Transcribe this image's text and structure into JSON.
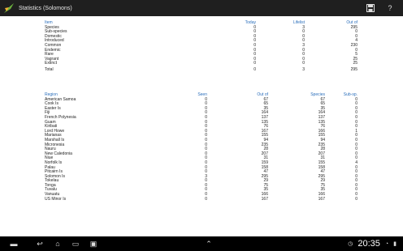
{
  "app": {
    "title": "Statistics (Solomons)",
    "icons": {
      "logo": "bird-logo-icon",
      "save": "save-icon",
      "help": "help-icon"
    }
  },
  "summary": {
    "headers": [
      "Item",
      "Today",
      "Lifelist",
      "Out of"
    ],
    "rows": [
      {
        "item": "Species",
        "today": "0",
        "lifelist": "3",
        "outof": "295"
      },
      {
        "item": "Sub-species",
        "today": "0",
        "lifelist": "0",
        "outof": "0"
      },
      {
        "item": "Domestic",
        "today": "0",
        "lifelist": "0",
        "outof": "0"
      },
      {
        "item": "Introduced",
        "today": "0",
        "lifelist": "0",
        "outof": "4"
      },
      {
        "item": "Common",
        "today": "0",
        "lifelist": "3",
        "outof": "230"
      },
      {
        "item": "Endemic",
        "today": "0",
        "lifelist": "0",
        "outof": "0"
      },
      {
        "item": "Rare",
        "today": "0",
        "lifelist": "0",
        "outof": "5"
      },
      {
        "item": "Vagrant",
        "today": "0",
        "lifelist": "0",
        "outof": "25"
      },
      {
        "item": "Extinct",
        "today": "0",
        "lifelist": "0",
        "outof": "25"
      },
      {
        "item": "Total",
        "today": "0",
        "lifelist": "3",
        "outof": "295"
      }
    ]
  },
  "regions": {
    "headers": [
      "Region",
      "Seen",
      "Out of",
      "Species",
      "Sub-sp."
    ],
    "rows": [
      {
        "region": "American Samoa",
        "seen": "0",
        "outof": "67",
        "species": "67",
        "subsp": "0"
      },
      {
        "region": "Cook Is",
        "seen": "0",
        "outof": "65",
        "species": "65",
        "subsp": "0"
      },
      {
        "region": "Easter Is",
        "seen": "0",
        "outof": "35",
        "species": "35",
        "subsp": "0"
      },
      {
        "region": "Fiji",
        "seen": "0",
        "outof": "164",
        "species": "164",
        "subsp": "0"
      },
      {
        "region": "French Polynesia",
        "seen": "0",
        "outof": "137",
        "species": "137",
        "subsp": "0"
      },
      {
        "region": "Guam",
        "seen": "0",
        "outof": "135",
        "species": "135",
        "subsp": "0"
      },
      {
        "region": "Kiribati",
        "seen": "0",
        "outof": "76",
        "species": "76",
        "subsp": "0"
      },
      {
        "region": "Lord Howe",
        "seen": "0",
        "outof": "167",
        "species": "166",
        "subsp": "1"
      },
      {
        "region": "Marianas",
        "seen": "0",
        "outof": "155",
        "species": "155",
        "subsp": "0"
      },
      {
        "region": "Marshall Is",
        "seen": "0",
        "outof": "94",
        "species": "94",
        "subsp": "0"
      },
      {
        "region": "Micronesia",
        "seen": "0",
        "outof": "235",
        "species": "235",
        "subsp": "0"
      },
      {
        "region": "Nauru",
        "seen": "0",
        "outof": "28",
        "species": "28",
        "subsp": "0"
      },
      {
        "region": "New Caledonia",
        "seen": "0",
        "outof": "207",
        "species": "207",
        "subsp": "0"
      },
      {
        "region": "Niue",
        "seen": "0",
        "outof": "31",
        "species": "31",
        "subsp": "0"
      },
      {
        "region": "Norfolk Is",
        "seen": "0",
        "outof": "159",
        "species": "155",
        "subsp": "4"
      },
      {
        "region": "Palau",
        "seen": "0",
        "outof": "158",
        "species": "158",
        "subsp": "0"
      },
      {
        "region": "Pitcairn Is",
        "seen": "0",
        "outof": "47",
        "species": "47",
        "subsp": "0"
      },
      {
        "region": "Solomon Is",
        "seen": "3",
        "outof": "295",
        "species": "295",
        "subsp": "0"
      },
      {
        "region": "Tokelau",
        "seen": "0",
        "outof": "29",
        "species": "29",
        "subsp": "0"
      },
      {
        "region": "Tonga",
        "seen": "0",
        "outof": "75",
        "species": "75",
        "subsp": "0"
      },
      {
        "region": "Tuvalu",
        "seen": "0",
        "outof": "35",
        "species": "35",
        "subsp": "0"
      },
      {
        "region": "Vanuatu",
        "seen": "0",
        "outof": "166",
        "species": "166",
        "subsp": "0"
      },
      {
        "region": "US Minor Is",
        "seen": "0",
        "outof": "167",
        "species": "167",
        "subsp": "0"
      }
    ]
  },
  "navbar": {
    "clock": "20:35",
    "icons": [
      "keyboard-icon",
      "back-icon",
      "home-icon",
      "recent-apps-icon",
      "screenshot-icon",
      "up-arrow-icon",
      "clock-icon",
      "wifi-icon",
      "battery-icon"
    ]
  },
  "colors": {
    "header_blue": "#2a6ebb",
    "appbar": "#1f1f1f",
    "navbar": "#000000"
  }
}
